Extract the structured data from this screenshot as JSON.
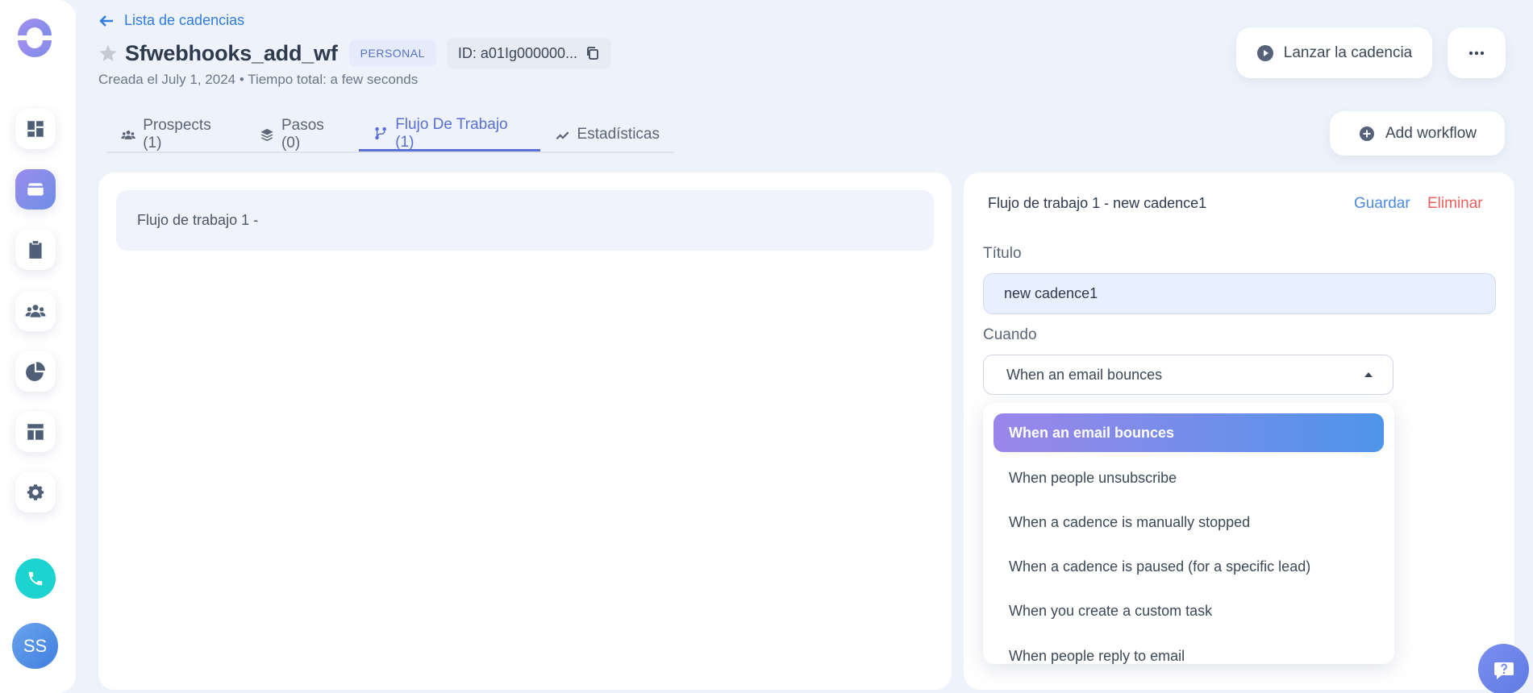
{
  "sidebar": {
    "items": [
      {
        "icon": "dashboard-icon"
      },
      {
        "icon": "cadences-icon",
        "active": true
      },
      {
        "icon": "tasks-icon"
      },
      {
        "icon": "people-icon"
      },
      {
        "icon": "reports-icon"
      },
      {
        "icon": "templates-icon"
      },
      {
        "icon": "gear-icon"
      }
    ],
    "phone_icon": "phone-icon",
    "avatar_initials": "SS"
  },
  "header": {
    "back_label": "Lista de cadencias",
    "title": "Sfwebhooks_add_wf",
    "badge": "PERSONAL",
    "id_text": "ID: a01Ig000000...",
    "subtitle": "Creada el July 1, 2024 • Tiempo total: a few seconds",
    "launch_label": "Lanzar la cadencia",
    "more_label": "•••"
  },
  "tabs": [
    {
      "label": "Prospects (1)",
      "icon": "people-icon"
    },
    {
      "label": "Pasos (0)",
      "icon": "layers-icon"
    },
    {
      "label": "Flujo De Trabajo (1)",
      "icon": "git-branch-icon",
      "active": true
    },
    {
      "label": "Estadísticas",
      "icon": "trend-icon"
    }
  ],
  "add_workflow_label": "Add workflow",
  "workflow_list": [
    {
      "label": "Flujo de trabajo 1 -"
    }
  ],
  "editor": {
    "title": "Flujo de trabajo 1 - new cadence1",
    "save_label": "Guardar",
    "delete_label": "Eliminar",
    "title_label": "Título",
    "title_value": "new cadence1",
    "when_label": "Cuando",
    "when_value": "When an email bounces"
  },
  "dropdown_options": [
    "When an email bounces",
    "When people unsubscribe",
    "When a cadence is manually stopped",
    "When a cadence is paused (for a specific lead)",
    "When you create a custom task",
    "When people reply to email"
  ],
  "colors": {
    "accent": "#5a6fd6",
    "link": "#2f7be0",
    "danger": "#ec5f5f",
    "phone": "#1dd3cf"
  }
}
